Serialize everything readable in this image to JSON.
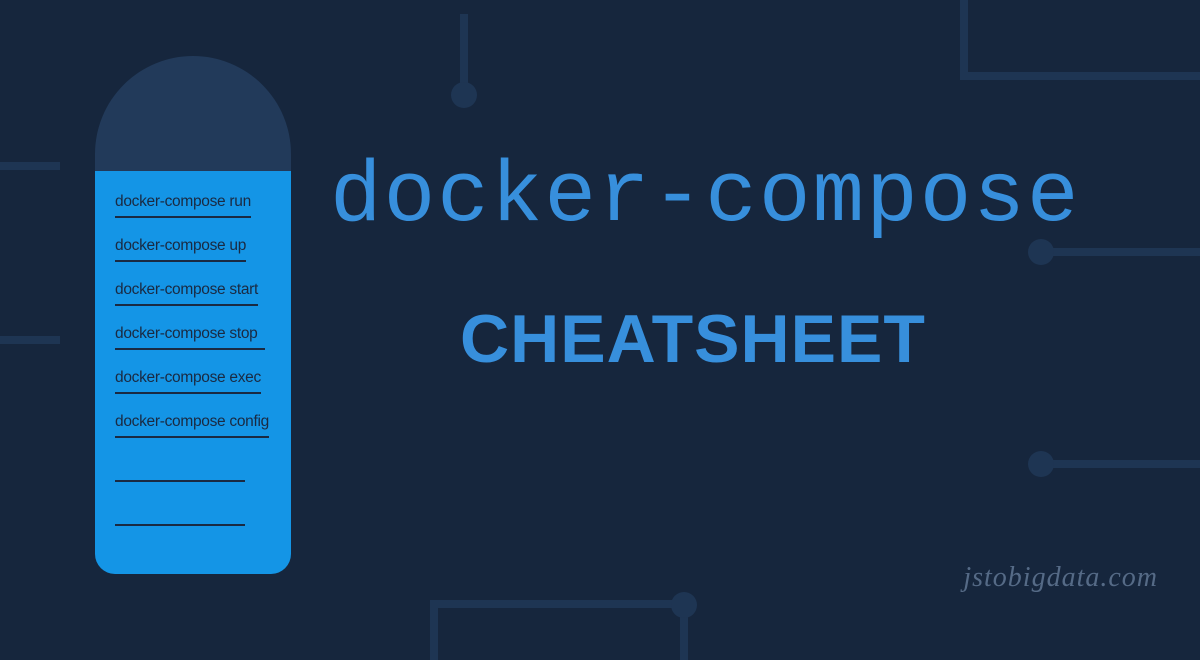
{
  "headline": "docker-compose",
  "subhead": "CHEATSHEET",
  "watermark": "jstobigdata.com",
  "commands": [
    "docker-compose run",
    "docker-compose up",
    "docker-compose start",
    "docker-compose stop",
    "docker-compose exec",
    "docker-compose config",
    "",
    ""
  ]
}
